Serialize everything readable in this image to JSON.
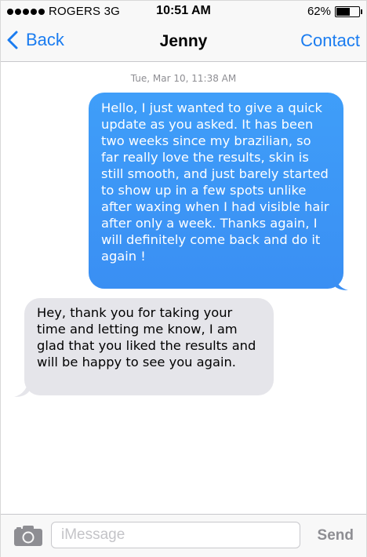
{
  "status_bar": {
    "carrier": "ROGERS 3G",
    "time": "10:51 AM",
    "battery_percent_label": "62%",
    "battery_level": 0.62,
    "signal_bars": 5
  },
  "nav": {
    "back_label": "Back",
    "title": "Jenny",
    "contact_label": "Contact"
  },
  "conversation": {
    "timestamp": "Tue, Mar 10, 11:38 AM",
    "messages": [
      {
        "direction": "sent",
        "text": "Hello, I just wanted to give a quick update as you asked. It has been two weeks since my brazilian, so far  really love the results, skin is still smooth, and just barely started to show up in a few spots unlike after waxing when I had visible hair after only a week. Thanks again, I will definitely come back and do it again !"
      },
      {
        "direction": "received",
        "text": "Hey, thank you for taking your time and letting me know, I am glad that you liked the results and will be happy to see you again."
      }
    ]
  },
  "input_bar": {
    "placeholder": "iMessage",
    "value": "",
    "send_label": "Send",
    "camera_icon": "camera-icon"
  },
  "colors": {
    "accent": "#1a7cf0",
    "sent_bubble": "#3e97f7",
    "received_bubble": "#e5e5ea",
    "send_disabled": "#8e8e93"
  }
}
